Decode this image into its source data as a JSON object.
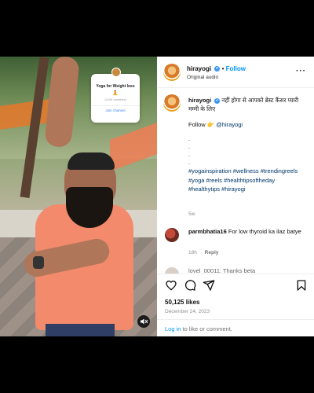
{
  "media": {
    "overlay_card": {
      "title": "Yoga for Weight loss",
      "emoji": "🧘",
      "members": "14.6K members",
      "join_label": "Join channel"
    },
    "mute_icon": "speaker-muted-icon"
  },
  "post": {
    "username": "hirayogi",
    "verified_icon": "✔",
    "follow_separator": "•",
    "follow_label": "Follow",
    "audio_label": "Original audio",
    "more_icon": "···"
  },
  "caption": {
    "username": "hirayogi",
    "text": "नहीं होगा से आपको ब्रेस्ट कैंसर प्यारी मम्मी के लिए",
    "follow_line": "Follow 👉",
    "mention": "@hirayogi",
    "dots": [
      ".",
      ".",
      ".",
      "."
    ],
    "hashtags": "#yogainspiration #wellness #trendingreels #yoga #reels #healthtipsoftheday #healthytips #hirayogi",
    "time_ago": "5w"
  },
  "comments": [
    {
      "username": "parmbhatia16",
      "text": "For low thyroid ka ilaz batye",
      "time": "18h",
      "reply_label": "Reply"
    },
    {
      "partial_text": "lovel_00011: Thanks beta"
    }
  ],
  "actions": {
    "like_icon": "heart-icon",
    "comment_icon": "comment-icon",
    "share_icon": "share-icon",
    "save_icon": "bookmark-icon"
  },
  "stats": {
    "likes": "50,125 likes",
    "date": "December 24, 2023"
  },
  "footer": {
    "login_link": "Log in",
    "login_suffix": "to like or comment."
  }
}
